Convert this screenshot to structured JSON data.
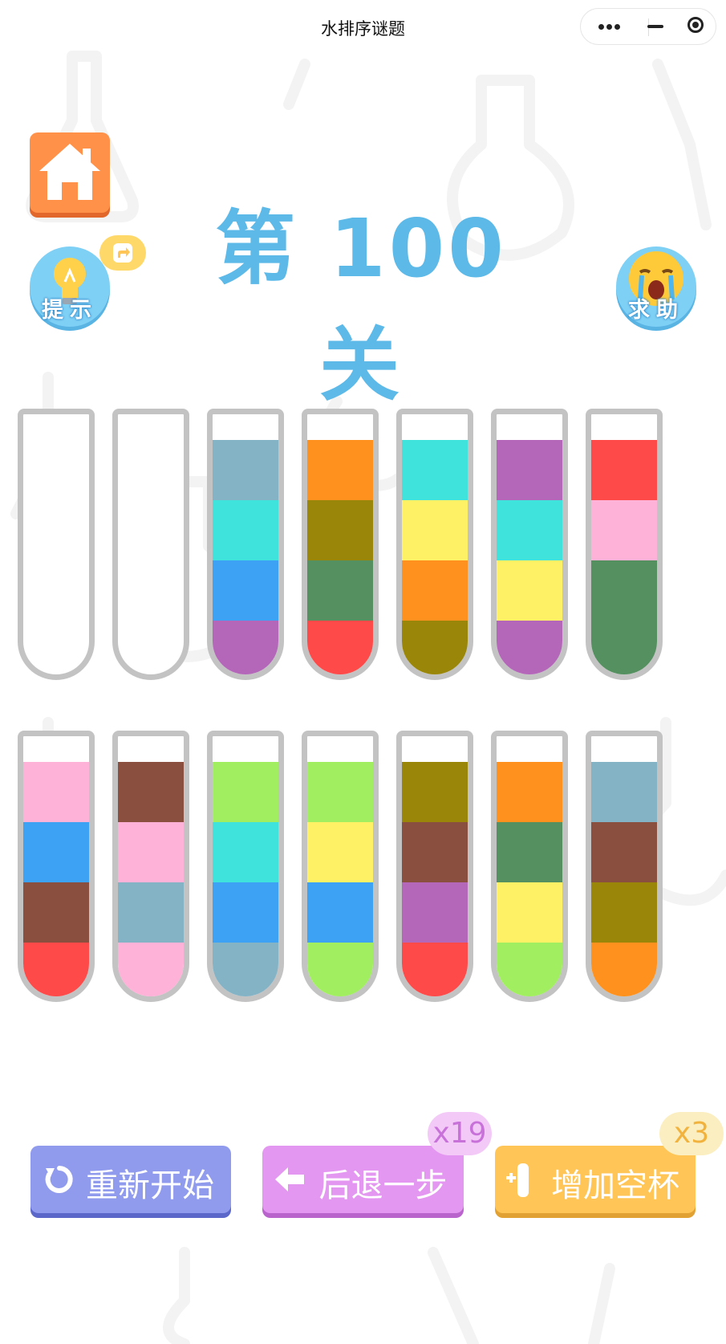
{
  "app": {
    "title": "水排序谜题"
  },
  "header": {
    "level_label": "第 100 关",
    "hint_label": "提示",
    "help_label": "求助"
  },
  "colors": {
    "steel_blue": "#85b3c6",
    "cyan": "#3fe3dc",
    "blue": "#3ea2f4",
    "purple": "#b467b9",
    "orange": "#ff921e",
    "olive": "#9a870a",
    "green": "#549060",
    "red": "#ff4a4a",
    "yellow": "#fff166",
    "pink": "#ffb2d8",
    "brown": "#8a4f3e",
    "lime": "#a1ee60"
  },
  "tubes": [
    {
      "row": 1,
      "layers": []
    },
    {
      "row": 1,
      "layers": []
    },
    {
      "row": 1,
      "layers": [
        "steel_blue",
        "cyan",
        "blue",
        "purple"
      ]
    },
    {
      "row": 1,
      "layers": [
        "orange",
        "olive",
        "green",
        "red"
      ]
    },
    {
      "row": 1,
      "layers": [
        "cyan",
        "yellow",
        "orange",
        "olive"
      ]
    },
    {
      "row": 1,
      "layers": [
        "purple",
        "cyan",
        "yellow",
        "purple"
      ]
    },
    {
      "row": 1,
      "layers": [
        "red",
        "pink",
        "green",
        "green"
      ]
    },
    {
      "row": 2,
      "layers": [
        "pink",
        "blue",
        "brown",
        "red"
      ]
    },
    {
      "row": 2,
      "layers": [
        "brown",
        "pink",
        "steel_blue",
        "pink"
      ]
    },
    {
      "row": 2,
      "layers": [
        "lime",
        "cyan",
        "blue",
        "steel_blue"
      ]
    },
    {
      "row": 2,
      "layers": [
        "lime",
        "yellow",
        "blue",
        "lime"
      ]
    },
    {
      "row": 2,
      "layers": [
        "olive",
        "brown",
        "purple",
        "red"
      ]
    },
    {
      "row": 2,
      "layers": [
        "orange",
        "green",
        "yellow",
        "lime"
      ]
    },
    {
      "row": 2,
      "layers": [
        "steel_blue",
        "brown",
        "olive",
        "orange"
      ]
    }
  ],
  "actions": {
    "restart_label": "重新开始",
    "undo_label": "后退一步",
    "undo_count": "x19",
    "add_cup_label": "增加空杯",
    "add_cup_count": "x3"
  }
}
